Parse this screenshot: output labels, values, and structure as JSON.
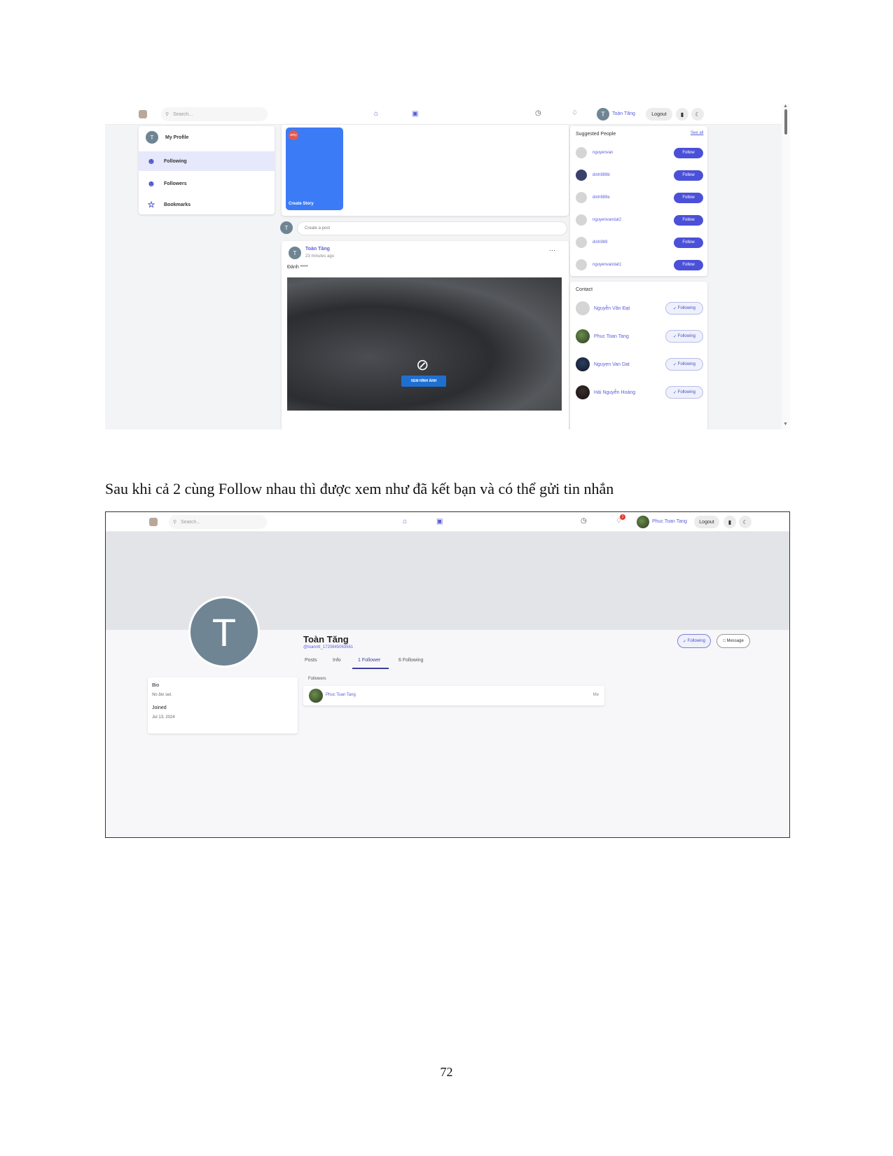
{
  "shot1": {
    "search_placeholder": "Search...",
    "user_name": "Toàn Tăng",
    "user_initial": "T",
    "logout": "Logout",
    "menu": [
      {
        "label": "My Profile"
      },
      {
        "label": "Following"
      },
      {
        "label": "Followers"
      },
      {
        "label": "Bookmarks"
      }
    ],
    "story": {
      "badge": "amy",
      "label": "Create Story"
    },
    "create_post": "Create a post",
    "post": {
      "author": "Toàn Tăng",
      "time": "23 minutes ago",
      "text": "Đánh ****",
      "more": "···",
      "view_button": "XEM HÌNH ẢNH"
    },
    "suggested": {
      "title": "Suggested People",
      "see_all": "See all",
      "follow_label": "Follow",
      "people": [
        "nguyenvan",
        "dinh989b",
        "dinh989e",
        "nguyenvandat2",
        "dinh989",
        "nguyenvandat1"
      ]
    },
    "contact": {
      "title": "Contact",
      "following_label": "Following",
      "people": [
        "Nguyễn Văn Đạt",
        "Phuc Toan Tang",
        "Nguyen Van Dat",
        "Hải Nguyễn Hoàng"
      ]
    }
  },
  "caption": "Sau khi cả 2 cùng Follow nhau thì được xem như đã kết bạn và có thể gửi tin nhắn",
  "shot2": {
    "search_placeholder": "Search...",
    "user_name": "Phuc Toan Tang",
    "logout": "Logout",
    "notif_count": "1",
    "profile": {
      "initial": "T",
      "name": "Toàn Tăng",
      "handle": "@toanntt_1720845063561",
      "following_button": "Following",
      "message_button": "Message"
    },
    "tabs": [
      "Posts",
      "Info",
      "1 Follower",
      "6 Following"
    ],
    "bio": {
      "bio_label": "Bio",
      "bio_value": "No bio set.",
      "joined_label": "Joined",
      "joined_value": "Jul 13, 2024"
    },
    "followers": {
      "title": "Followers",
      "items": [
        {
          "name": "Phuc Toan Tang",
          "tag": "Me"
        }
      ]
    }
  },
  "page_number": "72"
}
